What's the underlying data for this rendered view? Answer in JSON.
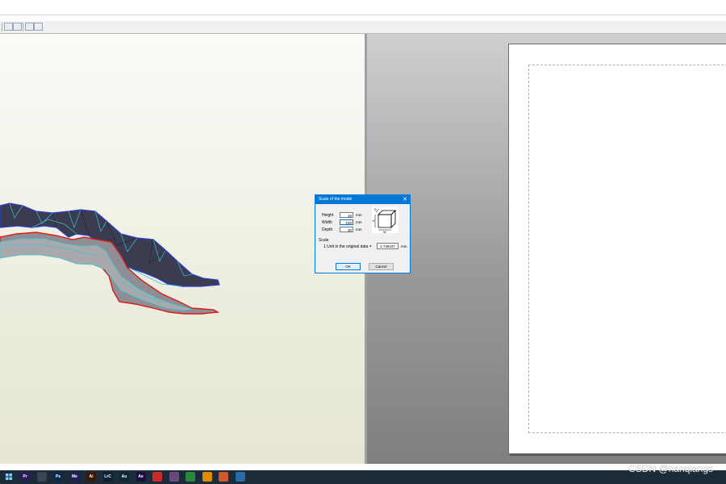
{
  "dialog": {
    "title": "Scale of the model",
    "close_glyph": "✕",
    "height_label": "Height",
    "height_value": "16",
    "width_label": "Width",
    "width_value": "100",
    "depth_label": "Depth",
    "depth_value": "30",
    "unit": "mm",
    "illustration_labels": {
      "d": "D",
      "h": "H",
      "w": "W"
    },
    "scale_section_label": "Scale",
    "scale_text": "1 Unit in the original data =",
    "scale_value": "2.739437",
    "scale_unit": "mm",
    "ok_label": "OK",
    "cancel_label": "Cancel"
  },
  "taskbar": {
    "apps": [
      {
        "name": "premiere-pro",
        "label": "Pr",
        "color": "#2a1b5a"
      },
      {
        "name": "app-3",
        "label": "",
        "color": "#3b4652"
      },
      {
        "name": "photoshop",
        "label": "Ps",
        "color": "#0a2a4a"
      },
      {
        "name": "media-encoder",
        "label": "Me",
        "color": "#1f1f55"
      },
      {
        "name": "illustrator",
        "label": "Ai",
        "color": "#3a1a05"
      },
      {
        "name": "lightroom-classic",
        "label": "LrC",
        "color": "#0b2236"
      },
      {
        "name": "audition",
        "label": "Au",
        "color": "#0b2a30"
      },
      {
        "name": "after-effects",
        "label": "Ae",
        "color": "#1a1040"
      },
      {
        "name": "app-9",
        "label": "",
        "color": "#cc2a2a"
      },
      {
        "name": "app-10",
        "label": "",
        "color": "#6a4a7a"
      },
      {
        "name": "app-11",
        "label": "",
        "color": "#2a8a3a"
      },
      {
        "name": "vlc",
        "label": "",
        "color": "#e08a00"
      },
      {
        "name": "app-13",
        "label": "",
        "color": "#d0582a"
      },
      {
        "name": "pepakura",
        "label": "",
        "color": "#2a6aa8"
      }
    ]
  },
  "watermark": "CSDN @hanqiangs"
}
